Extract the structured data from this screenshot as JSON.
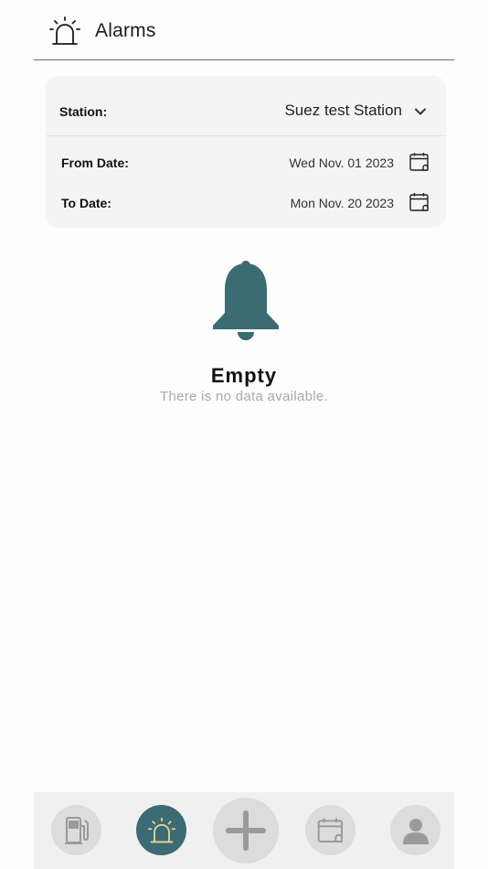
{
  "header": {
    "title": "Alarms",
    "icon": "siren-icon"
  },
  "filters": {
    "station_label": "Station:",
    "station_value": "Suez test Station",
    "from_label": "From Date:",
    "from_value": "Wed Nov. 01 2023",
    "to_label": "To Date:",
    "to_value": "Mon Nov. 20 2023"
  },
  "empty_state": {
    "icon": "bell-icon",
    "title": "Empty",
    "message": "There is no data available."
  },
  "bottom_nav": {
    "items": [
      {
        "name": "fuel",
        "icon": "fuel-pump-icon",
        "active": false
      },
      {
        "name": "alarms",
        "icon": "siren-icon",
        "active": true
      },
      {
        "name": "add",
        "icon": "plus-icon",
        "active": false
      },
      {
        "name": "calendar",
        "icon": "calendar-icon",
        "active": false
      },
      {
        "name": "profile",
        "icon": "user-icon",
        "active": false
      }
    ]
  },
  "colors": {
    "accent": "#3b6b73",
    "accent_icon": "#e6d79a",
    "inactive_button": "#dcdcdc",
    "inactive_icon": "#9a9a9a",
    "card_background": "#f4f4f4",
    "muted_text": "#a9a9a9"
  }
}
